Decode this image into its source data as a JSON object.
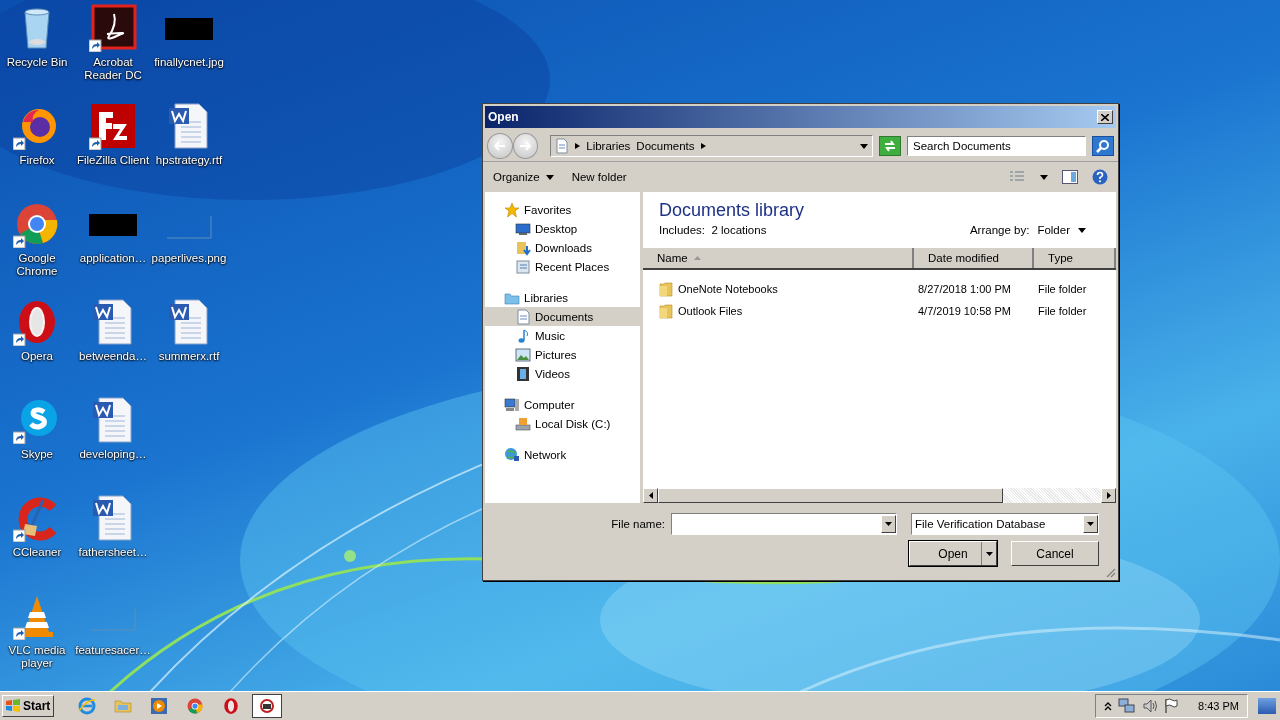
{
  "desktop_icons": [
    {
      "label": "Recycle Bin",
      "kind": "recycle",
      "shortcut": false
    },
    {
      "label": "Firefox",
      "kind": "firefox",
      "shortcut": true
    },
    {
      "label": "Google Chrome",
      "kind": "chrome",
      "shortcut": true
    },
    {
      "label": "Opera",
      "kind": "opera",
      "shortcut": true
    },
    {
      "label": "Skype",
      "kind": "skype",
      "shortcut": true
    },
    {
      "label": "CCleaner",
      "kind": "ccleaner",
      "shortcut": true
    },
    {
      "label": "VLC media player",
      "kind": "vlc",
      "shortcut": true
    },
    {
      "label": "Acrobat Reader DC",
      "kind": "acrobat",
      "shortcut": true
    },
    {
      "label": "FileZilla Client",
      "kind": "filezilla",
      "shortcut": true
    },
    {
      "label": "application…",
      "kind": "dark-image",
      "shortcut": false
    },
    {
      "label": "betweenda…",
      "kind": "word",
      "shortcut": false
    },
    {
      "label": "developing…",
      "kind": "word",
      "shortcut": false
    },
    {
      "label": "fathersheet…",
      "kind": "word",
      "shortcut": false
    },
    {
      "label": "featuresacer…",
      "kind": "blank-image",
      "shortcut": false
    },
    {
      "label": "finallycnet.jpg",
      "kind": "dark-image",
      "shortcut": false
    },
    {
      "label": "hpstrategy.rtf",
      "kind": "word",
      "shortcut": false
    },
    {
      "label": "paperlives.png",
      "kind": "blank-image",
      "shortcut": false
    },
    {
      "label": "summerx.rtf",
      "kind": "word",
      "shortcut": false
    }
  ],
  "dialog": {
    "title": "Open",
    "breadcrumb": [
      "Libraries",
      "Documents"
    ],
    "search": {
      "placeholder": "Search Documents"
    },
    "toolbar": [
      "Organize",
      "New folder"
    ],
    "nav": [
      {
        "label": "Favorites",
        "kind": "favorites",
        "selected": false,
        "children": [
          {
            "label": "Desktop",
            "kind": "desktop",
            "selected": false
          },
          {
            "label": "Downloads",
            "kind": "downloads",
            "selected": false
          },
          {
            "label": "Recent Places",
            "kind": "recent",
            "selected": false
          }
        ]
      },
      {
        "label": "Libraries",
        "kind": "libraries",
        "selected": false,
        "children": [
          {
            "label": "Documents",
            "kind": "documents",
            "selected": true
          },
          {
            "label": "Music",
            "kind": "music",
            "selected": false
          },
          {
            "label": "Pictures",
            "kind": "pictures",
            "selected": false
          },
          {
            "label": "Videos",
            "kind": "videos",
            "selected": false
          }
        ]
      },
      {
        "label": "Computer",
        "kind": "computer",
        "selected": false,
        "children": [
          {
            "label": "Local Disk (C:)",
            "kind": "disk",
            "selected": false
          }
        ]
      },
      {
        "label": "Network",
        "kind": "network",
        "selected": false
      }
    ],
    "library": {
      "title": "Documents library",
      "includes": "Includes:  2 locations",
      "arrange_label": "Arrange by:",
      "arrange_value": "Folder"
    },
    "columns": [
      {
        "label": "Name",
        "sorted": true
      },
      {
        "label": "Date modified",
        "sorted": false
      },
      {
        "label": "Type",
        "sorted": false
      }
    ],
    "rows": [
      {
        "name": "OneNote Notebooks",
        "date": "8/27/2018 1:00 PM",
        "type": "File folder"
      },
      {
        "name": "Outlook Files",
        "date": "4/7/2019 10:58 PM",
        "type": "File folder"
      }
    ],
    "file_name_label": "File name:",
    "file_type": "File Verification Database",
    "buttons": [
      "Open",
      "Cancel"
    ]
  },
  "taskbar": {
    "start": "Start",
    "apps": [
      {
        "kind": "ie",
        "selected": false
      },
      {
        "kind": "explorer",
        "selected": false
      },
      {
        "kind": "media",
        "selected": false
      },
      {
        "kind": "chrome",
        "selected": false
      },
      {
        "kind": "opera",
        "selected": false
      },
      {
        "kind": "app",
        "selected": true
      }
    ],
    "time": "8:43 PM"
  }
}
